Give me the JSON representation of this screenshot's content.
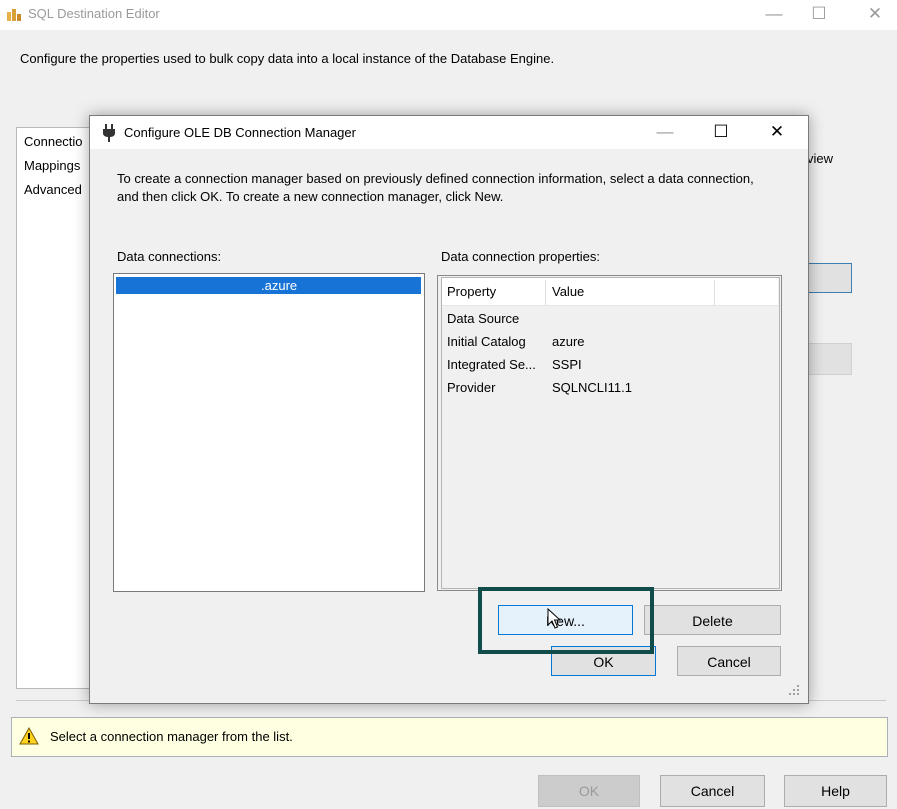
{
  "background_window": {
    "title": "SQL Destination Editor",
    "instructions": "Configure the properties used to bulk copy data into a local instance of the Database Engine.",
    "nav_items": [
      "Connectio",
      "Mappings",
      "Advanced"
    ],
    "partial_text": "view",
    "status_text": "Select a connection manager from the list.",
    "buttons": {
      "ok": "OK",
      "cancel": "Cancel",
      "help": "Help"
    },
    "title_controls": {
      "minimize": "—",
      "maximize": "☐",
      "close": "✕"
    }
  },
  "dialog": {
    "title": "Configure OLE DB Connection Manager",
    "instructions": "To create a connection manager based on previously defined connection information, select a data connection, and then click OK. To create a new connection manager, click New.",
    "data_connections_label": "Data connections:",
    "data_connections": [
      ".azure"
    ],
    "properties_label": "Data connection properties:",
    "property_columns": {
      "property": "Property",
      "value": "Value"
    },
    "properties": [
      {
        "name": "Data Source",
        "value": ""
      },
      {
        "name": "Initial Catalog",
        "value": "azure"
      },
      {
        "name": "Integrated Se...",
        "value": "SSPI"
      },
      {
        "name": "Provider",
        "value": "SQLNCLI11.1"
      }
    ],
    "buttons": {
      "new": "New...",
      "delete": "Delete",
      "ok": "OK",
      "cancel": "Cancel"
    },
    "title_controls": {
      "minimize": "—",
      "maximize": "☐",
      "close": "✕"
    }
  },
  "icons": [
    "app-icon",
    "plug-icon",
    "warning-icon",
    "mouse-cursor-icon",
    "resize-grip-icon"
  ],
  "colors": {
    "selection": "#1873d6",
    "highlight_box": "#104d4a",
    "status_background": "#ffffe1",
    "focus_border": "#0078d7"
  }
}
